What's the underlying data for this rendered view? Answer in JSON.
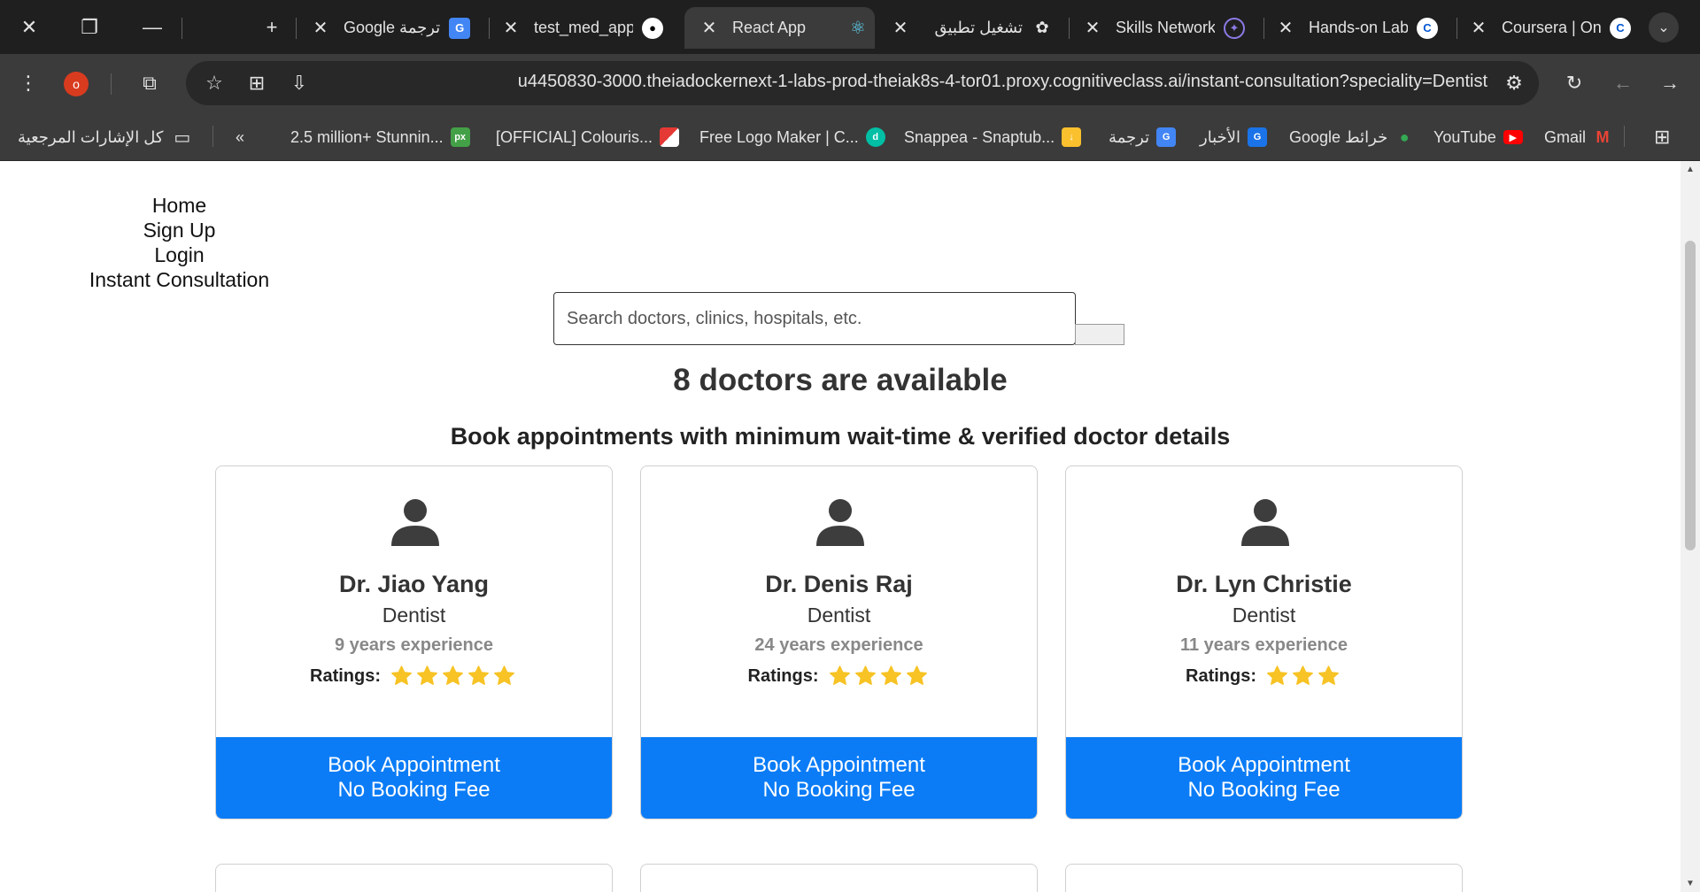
{
  "browser": {
    "tabs": [
      {
        "title": "Google ترجمة",
        "icon": "google-translate-icon"
      },
      {
        "title": "test_med_app",
        "icon": "github-icon"
      },
      {
        "title": "React App",
        "icon": "react-icon",
        "active": true
      },
      {
        "title": "تشغيل تطبيق",
        "icon": "openai-icon"
      },
      {
        "title": "Skills Network",
        "icon": "skills-network-icon"
      },
      {
        "title": "Hands-on Lab",
        "icon": "coursera-icon"
      },
      {
        "title": "Coursera | Onl",
        "icon": "coursera-icon"
      }
    ],
    "profile_initial": "o",
    "url": "u4450830-3000.theiadockernext-1-labs-prod-theiak8s-4-tor01.proxy.cognitiveclass.ai/instant-consultation?speciality=Dentist",
    "bookmarks": [
      {
        "label": "2.5 million+ Stunnin...",
        "icon": "px-icon",
        "color": "#43a047",
        "glyph": "px"
      },
      {
        "label": "[OFFICIAL] Colouris...",
        "icon": "colouris-icon",
        "color": "#e53935",
        "glyph": ""
      },
      {
        "label": "Free Logo Maker | C...",
        "icon": "logo-maker-icon",
        "color": "#00bfa5",
        "glyph": "d"
      },
      {
        "label": "Snappea - Snaptub...",
        "icon": "snappea-icon",
        "color": "#fbc02d",
        "glyph": "↓"
      },
      {
        "label": "ترجمة",
        "icon": "google-translate-icon",
        "color": "#4285f4",
        "glyph": "G"
      },
      {
        "label": "الأخبار",
        "icon": "google-news-icon",
        "color": "#1a73e8",
        "glyph": "G"
      },
      {
        "label": "Google خرائط",
        "icon": "google-maps-icon",
        "color": "#34a853",
        "glyph": "●"
      },
      {
        "label": "YouTube",
        "icon": "youtube-icon",
        "color": "#ff0000",
        "glyph": "▶"
      },
      {
        "label": "Gmail",
        "icon": "gmail-icon",
        "color": "#ea4335",
        "glyph": "M"
      }
    ],
    "all_bookmarks": "كل الإشارات المرجعية"
  },
  "nav": {
    "home": "Home",
    "signup": "Sign Up",
    "login": "Login",
    "instant": "Instant Consultation"
  },
  "search": {
    "placeholder": "Search doctors, clinics, hospitals, etc."
  },
  "results": {
    "count_text": "8 doctors are available",
    "subtitle": "Book appointments with minimum wait-time & verified doctor details"
  },
  "doctors": [
    {
      "name": "Dr. Jiao Yang",
      "speciality": "Dentist",
      "experience": "9 years experience",
      "ratings_label": "Ratings:",
      "stars": 5,
      "button_line1": "Book Appointment",
      "button_line2": "No Booking Fee"
    },
    {
      "name": "Dr. Denis Raj",
      "speciality": "Dentist",
      "experience": "24 years experience",
      "ratings_label": "Ratings:",
      "stars": 4,
      "button_line1": "Book Appointment",
      "button_line2": "No Booking Fee"
    },
    {
      "name": "Dr. Lyn Christie",
      "speciality": "Dentist",
      "experience": "11 years experience",
      "ratings_label": "Ratings:",
      "stars": 3,
      "button_line1": "Book Appointment",
      "button_line2": "No Booking Fee"
    }
  ],
  "colors": {
    "accent": "#0b7cf6",
    "star": "#f7c325"
  }
}
